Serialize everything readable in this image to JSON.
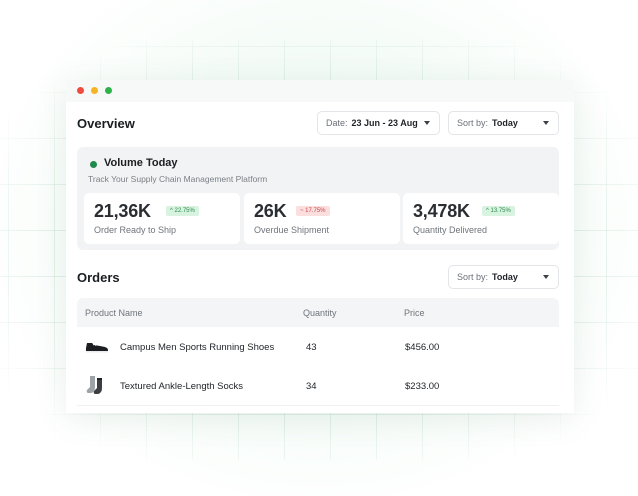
{
  "overview": {
    "title": "Overview",
    "date_filter": {
      "label": "Date:",
      "value": "23 Jun - 23 Aug"
    },
    "sort": {
      "label": "Sort by:",
      "value": "Today"
    }
  },
  "volume": {
    "title": "Volume Today",
    "subtitle": "Track Your Supply Chain  Management Platform",
    "status_color": "#1f8a4c",
    "stats": [
      {
        "value": "21,36K",
        "change": "^ 22.75%",
        "trend": "up",
        "caption": "Order Ready to Ship"
      },
      {
        "value": "26K",
        "change": "~ 17.75%",
        "trend": "down",
        "caption": "Overdue Shipment"
      },
      {
        "value": "3,478K",
        "change": "^ 13.75%",
        "trend": "up",
        "caption": "Quantity Delivered"
      }
    ]
  },
  "orders": {
    "title": "Orders",
    "sort": {
      "label": "Sort by:",
      "value": "Today"
    },
    "columns": [
      "Product Name",
      "Quantity",
      "Price"
    ],
    "rows": [
      {
        "product": "Campus Men Sports Running Shoes",
        "quantity": "43",
        "price": "$456.00",
        "icon": "shoe-icon"
      },
      {
        "product": "Textured Ankle-Length Socks",
        "quantity": "34",
        "price": "$233.00",
        "icon": "socks-icon"
      }
    ]
  },
  "colors": {
    "up_bg": "#d8f3df",
    "up_text": "#2f8a4f",
    "down_bg": "#fbdede",
    "down_text": "#c74848"
  }
}
